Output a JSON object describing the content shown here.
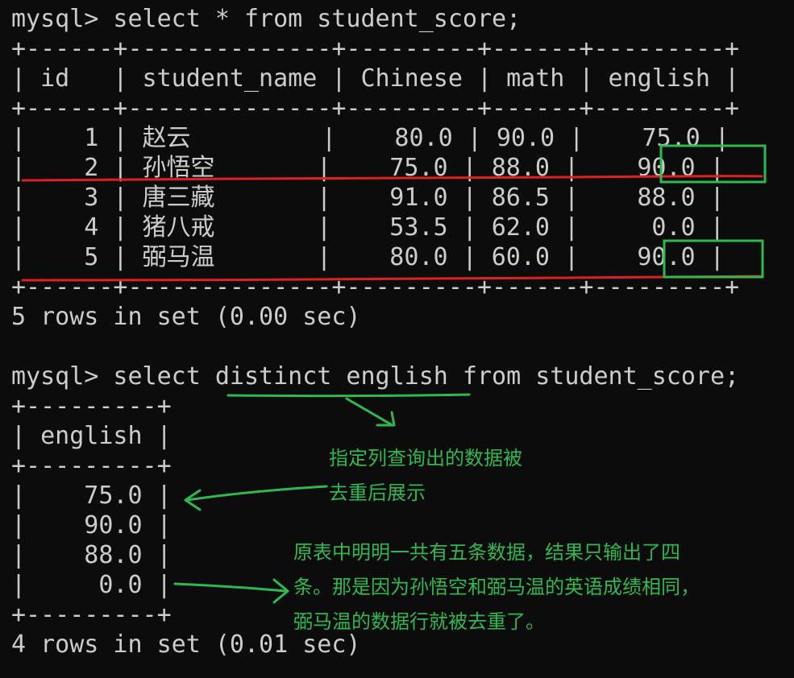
{
  "terminal": {
    "query1": {
      "command": "mysql> select * from student_score;",
      "border": "+------+--------------+---------+------+---------+",
      "header": "| id   | student_name | Chinese | math | english |",
      "columns": [
        "id",
        "student_name",
        "Chinese",
        "math",
        "english"
      ],
      "rows": [
        "|    1 | 赵云         |    80.0 | 90.0 |    75.0 |",
        "|    2 | 孙悟空       |    75.0 | 88.0 |    90.0 |",
        "|    3 | 唐三藏       |    91.0 | 86.5 |    88.0 |",
        "|    4 | 猪八戒       |    53.5 | 62.0 |     0.0 |",
        "|    5 | 弼马温       |    80.0 | 60.0 |    90.0 |"
      ],
      "records": [
        {
          "id": "1",
          "student_name": "赵云",
          "Chinese": "80.0",
          "math": "90.0",
          "english": "75.0"
        },
        {
          "id": "2",
          "student_name": "孙悟空",
          "Chinese": "75.0",
          "math": "88.0",
          "english": "90.0"
        },
        {
          "id": "3",
          "student_name": "唐三藏",
          "Chinese": "91.0",
          "math": "86.5",
          "english": "88.0"
        },
        {
          "id": "4",
          "student_name": "猪八戒",
          "Chinese": "53.5",
          "math": "62.0",
          "english": "0.0"
        },
        {
          "id": "5",
          "student_name": "弼马温",
          "Chinese": "80.0",
          "math": "60.0",
          "english": "90.0"
        }
      ],
      "footer": "5 rows in set (0.00 sec)"
    },
    "query2": {
      "prompt": "mysql> select ",
      "highlight": "distinct english",
      "rest": " from student_score;",
      "border": "+---------+",
      "header": "| english |",
      "rows": [
        "|    75.0 |",
        "|    90.0 |",
        "|    88.0 |",
        "|     0.0 |"
      ],
      "values": [
        "75.0",
        "90.0",
        "88.0",
        "0.0"
      ],
      "footer": "4 rows in set (0.01 sec)"
    }
  },
  "annotations": {
    "note1": [
      "指定列查询出的数据被",
      "去重后展示"
    ],
    "note2": [
      "原表中明明一共有五条数据，结果只输出了四",
      "条。那是因为孙悟空和弼马温的英语成绩相同，",
      "弼马温的数据行就被去重了。"
    ]
  },
  "colors": {
    "background": "#0c0c0c",
    "text": "#cccccc",
    "annotation_green": "#2fb84f",
    "annotation_red": "#e02020"
  }
}
